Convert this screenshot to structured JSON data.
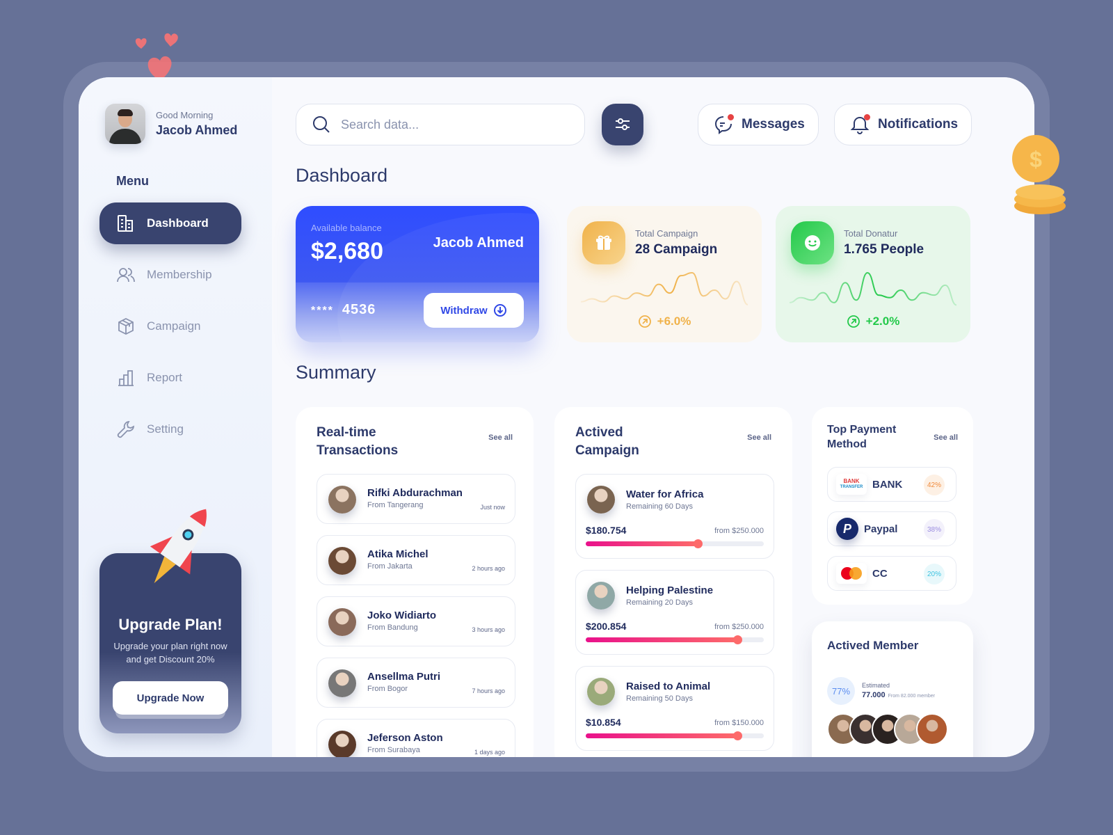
{
  "user": {
    "greeting": "Good Morning",
    "name": "Jacob Ahmed"
  },
  "sidebar": {
    "menu_label": "Menu",
    "items": [
      {
        "label": "Dashboard",
        "icon": "building-icon",
        "active": true
      },
      {
        "label": "Membership",
        "icon": "users-icon",
        "active": false
      },
      {
        "label": "Campaign",
        "icon": "box-icon",
        "active": false
      },
      {
        "label": "Report",
        "icon": "bar-chart-icon",
        "active": false
      },
      {
        "label": "Setting",
        "icon": "wrench-icon",
        "active": false
      }
    ],
    "upgrade": {
      "title": "Upgrade Plan!",
      "description": "Upgrade your plan right now and get Discount 20%",
      "button": "Upgrade Now"
    }
  },
  "topbar": {
    "search_placeholder": "Search data...",
    "search_value": "",
    "messages_label": "Messages",
    "notifications_label": "Notifications"
  },
  "dashboard": {
    "title": "Dashboard",
    "balance_card": {
      "label": "Available balance",
      "amount": "$2,680",
      "holder": "Jacob Ahmed",
      "card_mask": "****",
      "card_last4": "4536",
      "withdraw_label": "Withdraw"
    },
    "stats": [
      {
        "label": "Total Campaign",
        "value": "28 Campaign",
        "delta": "+6.0%",
        "color": "#f0b24a",
        "sparkline": [
          2,
          3,
          2,
          4,
          3,
          5,
          4,
          8,
          5,
          11,
          12,
          4,
          6,
          3,
          9,
          1
        ]
      },
      {
        "label": "Total Donatur",
        "value": "1.765 People",
        "delta": "+2.0%",
        "color": "#23c94a",
        "sparkline": [
          2,
          4,
          3,
          6,
          2,
          10,
          3,
          14,
          5,
          4,
          7,
          3,
          6,
          5,
          9,
          1
        ]
      }
    ]
  },
  "summary": {
    "title": "Summary",
    "transactions": {
      "title": "Real-time Transactions",
      "see_all": "See all",
      "items": [
        {
          "name": "Rifki Abdurachman",
          "from": "From Tangerang",
          "time": "Just now",
          "avatar_color": "#8b7360"
        },
        {
          "name": "Atika Michel",
          "from": "From Jakarta",
          "time": "2 hours ago",
          "avatar_color": "#6b4a35"
        },
        {
          "name": "Joko Widiarto",
          "from": "From Bandung",
          "time": "3 hours ago",
          "avatar_color": "#8a6a5a"
        },
        {
          "name": "Ansellma Putri",
          "from": "From Bogor",
          "time": "7 hours ago",
          "avatar_color": "#777"
        },
        {
          "name": "Jeferson Aston",
          "from": "From  Surabaya",
          "time": "1 days ago",
          "avatar_color": "#5a3a2a"
        }
      ]
    },
    "campaigns": {
      "title": "Actived Campaign",
      "see_all": "See all",
      "items": [
        {
          "name": "Water for Africa",
          "remaining": "Remaining 60 Days",
          "raised": "$180.754",
          "goal": "from $250.000",
          "progress": 0.63,
          "avatar_color": "#7a6450"
        },
        {
          "name": "Helping Palestine",
          "remaining": "Remaining 20 Days",
          "raised": "$200.854",
          "goal": "from $250.000",
          "progress": 0.85,
          "avatar_color": "#8fa8a6"
        },
        {
          "name": "Raised to Animal",
          "remaining": "Remaining 50 Days",
          "raised": "$10.854",
          "goal": "from $150.000",
          "progress": 0.85,
          "avatar_color": "#9aaa7a"
        }
      ]
    },
    "payments": {
      "title": "Top Payment Method",
      "see_all": "See all",
      "items": [
        {
          "name": "BANK",
          "logo": "bank-transfer-logo",
          "logo_text_top": "BANK",
          "logo_text_bottom": "TRANSFER",
          "percent": "42%",
          "color": "#f08a3c",
          "bg": "#fdf0e4"
        },
        {
          "name": "Paypal",
          "logo": "paypal-logo",
          "percent": "38%",
          "color": "#9a8ce0",
          "bg": "#f3f1fb"
        },
        {
          "name": "CC",
          "logo": "mastercard-logo",
          "percent": "20%",
          "color": "#3cc3e0",
          "bg": "#e8f8fb"
        }
      ]
    },
    "members": {
      "title": "Actived Member",
      "percent": "77%",
      "estimated_label": "Estimated",
      "count": "77.000",
      "total": "From 82.000 member",
      "avatar_colors": [
        "#8a6a50",
        "#3a3030",
        "#2a2220",
        "#b8a898",
        "#b05a30"
      ]
    }
  }
}
